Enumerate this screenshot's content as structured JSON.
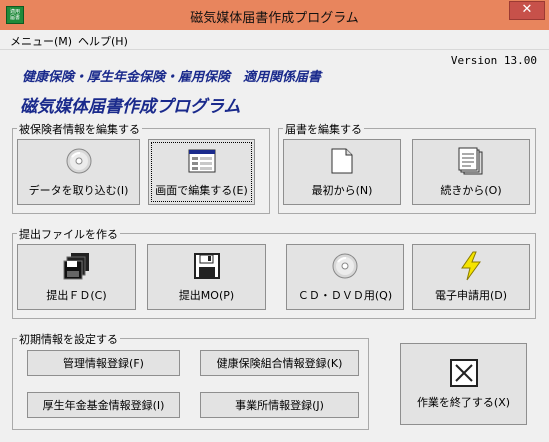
{
  "window": {
    "title": "磁気媒体届書作成プログラム",
    "icon_text": "適用\n届書",
    "close_label": "✕"
  },
  "menu": {
    "items": [
      "メニュー(M)",
      "ヘルプ(H)"
    ]
  },
  "header": {
    "version": "Version 13.00",
    "subtitle": "健康保険・厚生年金保険・雇用保険　適用関係届書",
    "title": "磁気媒体届書作成プログラム"
  },
  "groups": {
    "edit_insured": {
      "label": "被保険者情報を編集する",
      "import_button": "データを取り込む(I)",
      "screen_edit_button": "画面で編集する(E)"
    },
    "edit_report": {
      "label": "届書を編集する",
      "new_button": "最初から(N)",
      "continue_button": "続きから(O)"
    },
    "make_file": {
      "label": "提出ファイルを作る",
      "fd_button": "提出ＦＤ(C)",
      "mo_button": "提出MO(P)",
      "cd_button": "ＣＤ・ＤＶＤ用(Q)",
      "e_apply_button": "電子申請用(D)"
    },
    "initial_setup": {
      "label": "初期情報を設定する",
      "admin_button": "管理情報登録(F)",
      "health_union_button": "健康保険組合情報登録(K)",
      "pension_fund_button": "厚生年金基金情報登録(I)",
      "office_button": "事業所情報登録(J)"
    }
  },
  "exit_button": "作業を終了する(X)"
}
